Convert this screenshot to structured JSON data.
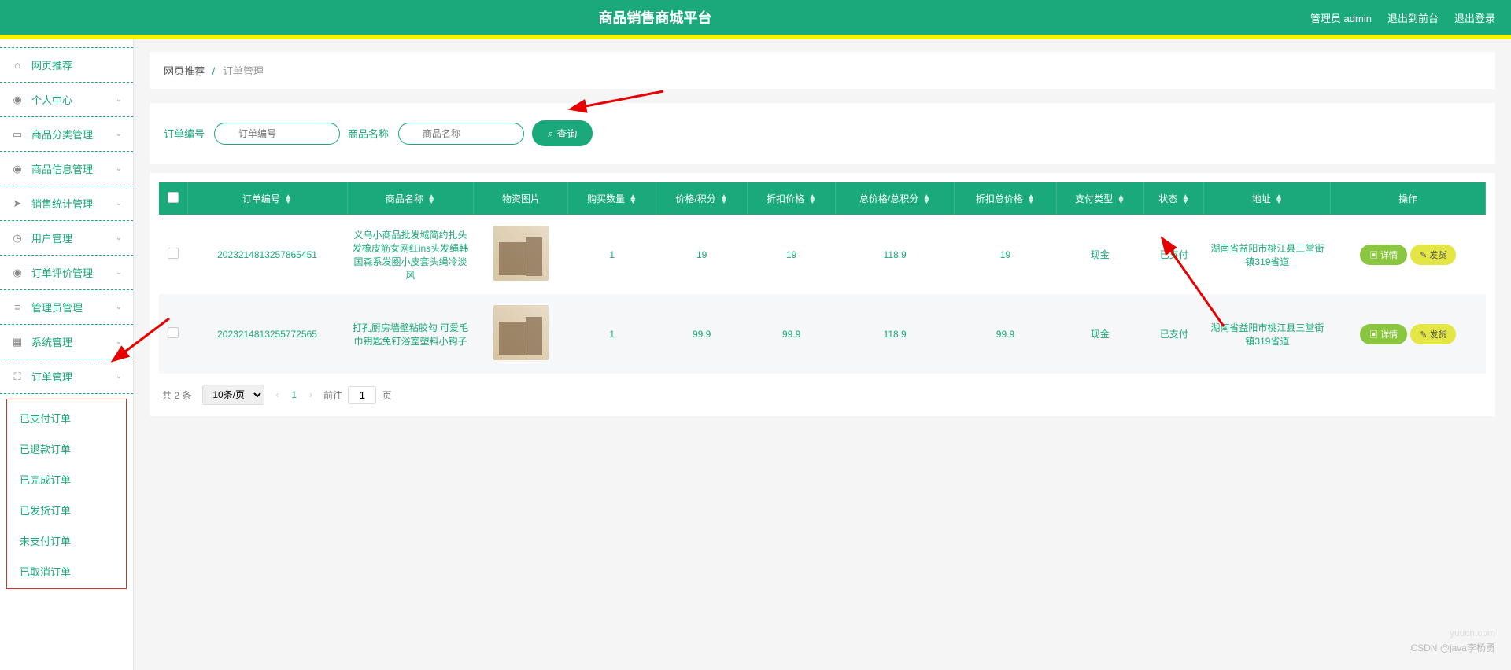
{
  "header": {
    "title": "商品销售商城平台",
    "admin_label": "管理员 admin",
    "exit_front": "退出到前台",
    "logout": "退出登录"
  },
  "sidebar": {
    "items": [
      {
        "label": "网页推荐",
        "icon": "home-icon",
        "expandable": false
      },
      {
        "label": "个人中心",
        "icon": "user-icon",
        "expandable": true
      },
      {
        "label": "商品分类管理",
        "icon": "monitor-icon",
        "expandable": true
      },
      {
        "label": "商品信息管理",
        "icon": "user-icon",
        "expandable": true
      },
      {
        "label": "销售统计管理",
        "icon": "send-icon",
        "expandable": true
      },
      {
        "label": "用户管理",
        "icon": "clock-icon",
        "expandable": true
      },
      {
        "label": "订单评价管理",
        "icon": "user-icon",
        "expandable": true
      },
      {
        "label": "管理员管理",
        "icon": "list-icon",
        "expandable": true
      },
      {
        "label": "系统管理",
        "icon": "box-icon",
        "expandable": true
      },
      {
        "label": "订单管理",
        "icon": "expand-icon",
        "expandable": true
      }
    ],
    "submenu": [
      "已支付订单",
      "已退款订单",
      "已完成订单",
      "已发货订单",
      "未支付订单",
      "已取消订单"
    ]
  },
  "breadcrumb": {
    "root": "网页推荐",
    "sep": "/",
    "current": "订单管理"
  },
  "search": {
    "order_label": "订单编号",
    "order_placeholder": "订单编号",
    "product_label": "商品名称",
    "product_placeholder": "商品名称",
    "btn": "查询"
  },
  "table": {
    "headers": [
      "订单编号",
      "商品名称",
      "物资图片",
      "购买数量",
      "价格/积分",
      "折扣价格",
      "总价格/总积分",
      "折扣总价格",
      "支付类型",
      "状态",
      "地址",
      "操作"
    ],
    "rows": [
      {
        "order_no": "2023214813257865451",
        "name": "义乌小商品批发城简约扎头发橡皮筋女网红ins头发绳韩国森系发圈小皮套头绳冷淡风",
        "qty": "1",
        "price": "19",
        "disc_price": "19",
        "total": "118.9",
        "disc_total": "19",
        "pay_type": "现金",
        "status": "已支付",
        "address": "湖南省益阳市桃江县三堂街镇319省道"
      },
      {
        "order_no": "2023214813255772565",
        "name": "打孔厨房墙壁粘胶勾 可爱毛巾钥匙免钉浴室塑料小钩子",
        "qty": "1",
        "price": "99.9",
        "disc_price": "99.9",
        "total": "118.9",
        "disc_total": "99.9",
        "pay_type": "现金",
        "status": "已支付",
        "address": "湖南省益阳市桃江县三堂街镇319省道"
      }
    ],
    "actions": {
      "detail": "详情",
      "ship": "发货"
    }
  },
  "pager": {
    "total_label": "共 2 条",
    "size": "10条/页",
    "page": "1",
    "jump_prefix": "前往",
    "jump_value": "1",
    "jump_suffix": "页"
  },
  "watermark": {
    "w1": "yuucn.com",
    "w2": "CSDN @java李杨勇"
  }
}
